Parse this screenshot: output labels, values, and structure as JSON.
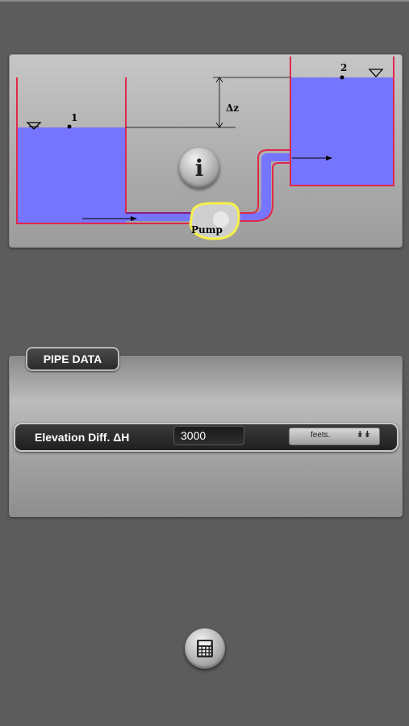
{
  "diagram": {
    "point1_label": "1",
    "point2_label": "2",
    "delta_z_label": "Δz",
    "pump_label": "Pump",
    "water_color": "#7575ff",
    "wall_color": "#e0284a",
    "pump_outline_color": "#f5f04a",
    "info_label": "i"
  },
  "pipe_data": {
    "section_title": "PIPE DATA",
    "elevation_label": "Elevation Diff.  ΔH",
    "elevation_value": "3000",
    "unit_selected": "feets."
  },
  "icons": {
    "info": "info-icon",
    "calculator": "calculator-icon",
    "dropdown": "chevron-double-down-icon"
  }
}
